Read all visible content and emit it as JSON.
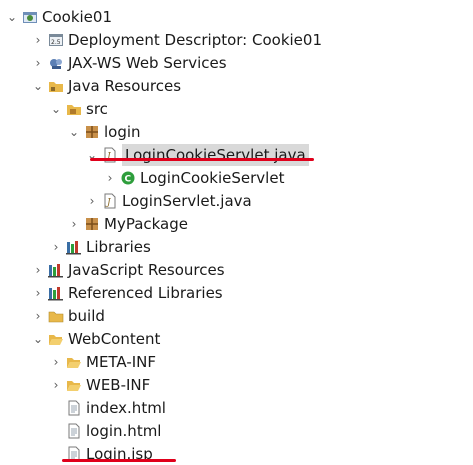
{
  "tree": {
    "project": "Cookie01",
    "deployment_descriptor": "Deployment Descriptor: Cookie01",
    "jaxws": "JAX-WS Web Services",
    "java_resources": "Java Resources",
    "src": "src",
    "pkg_login": "login",
    "login_cookie_servlet_java": "LoginCookieServlet.java",
    "login_cookie_servlet_class": "LoginCookieServlet",
    "login_servlet_java": "LoginServlet.java",
    "my_package": "MyPackage",
    "libraries": "Libraries",
    "javascript_resources": "JavaScript Resources",
    "referenced_libraries": "Referenced Libraries",
    "build": "build",
    "webcontent": "WebContent",
    "meta_inf": "META-INF",
    "web_inf": "WEB-INF",
    "index_html": "index.html",
    "login_html": "login.html",
    "login_jsp": "Login.jsp"
  },
  "colors": {
    "highlight_underline": "#e0001b",
    "selection": "#d9d9d9",
    "folder": "#e8b84a",
    "package": "#b07a2a",
    "class_green": "#2e9e3c"
  }
}
